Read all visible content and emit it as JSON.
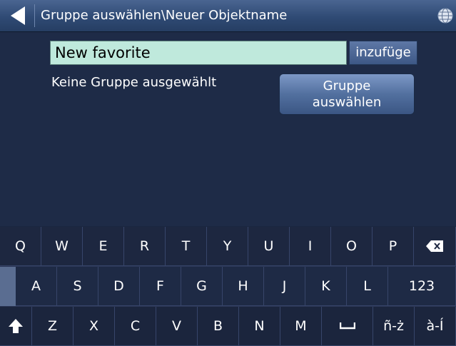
{
  "header": {
    "title": "Gruppe auswählen\\Neuer Objektname",
    "back_icon": "back-arrow-icon",
    "globe_icon": "globe-icon"
  },
  "form": {
    "name_value": "New favorite",
    "add_label": "inzufüge",
    "no_group_text": "Keine Gruppe ausgewählt",
    "group_button_line1": "Gruppe",
    "group_button_line2": "auswählen"
  },
  "keyboard": {
    "row1": [
      "Q",
      "W",
      "E",
      "R",
      "T",
      "Y",
      "U",
      "I",
      "O",
      "P"
    ],
    "backspace_icon": "backspace-icon",
    "row2": [
      "A",
      "S",
      "D",
      "F",
      "G",
      "H",
      "J",
      "K",
      "L"
    ],
    "numbers_label": "123",
    "shift_icon": "shift-icon",
    "row3": [
      "Z",
      "X",
      "C",
      "V",
      "B",
      "N",
      "M"
    ],
    "space_icon": "space-bar-icon",
    "accent1_label": "ñ-ż",
    "accent2_label": "à-Í"
  },
  "colors": {
    "background": "#1e2b47",
    "title_bar": "#2f4a74",
    "input_background": "#bfe9dc",
    "key_background": "#1d2740"
  }
}
